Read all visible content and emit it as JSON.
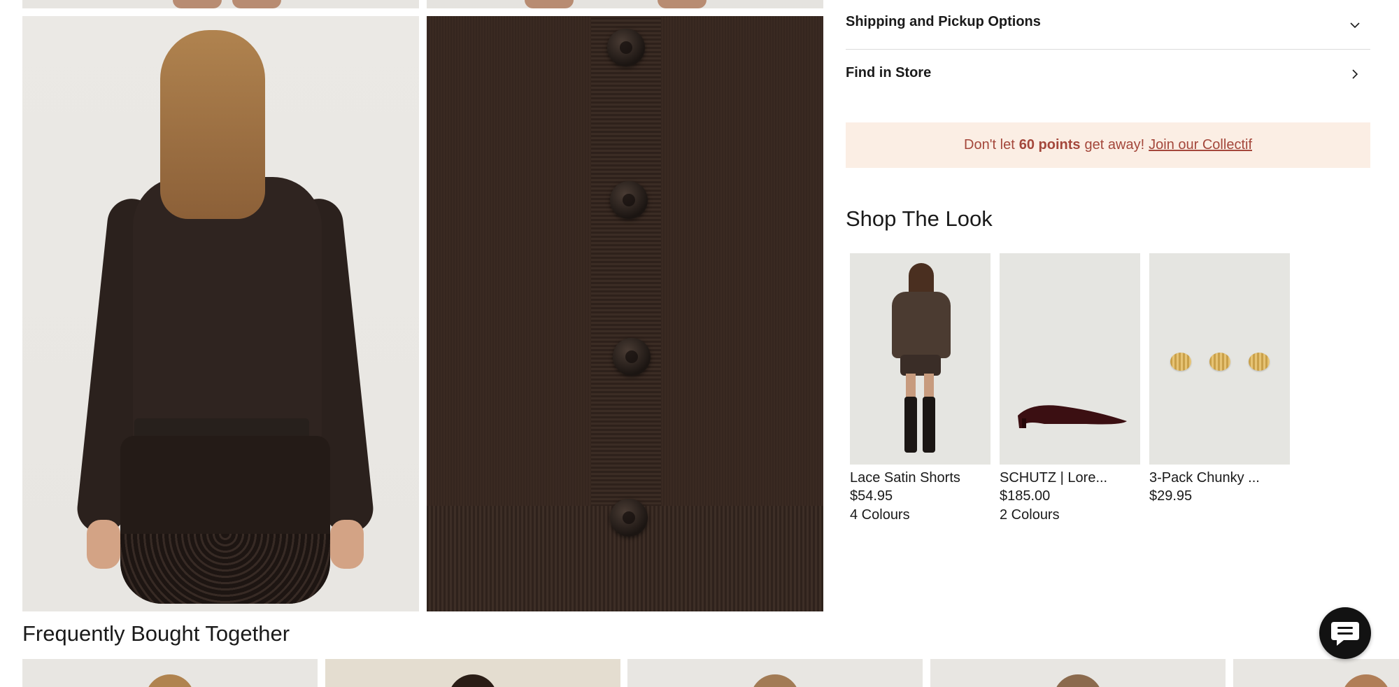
{
  "accordion": {
    "shipping_label": "Shipping and Pickup Options",
    "find_store_label": "Find in Store"
  },
  "promo": {
    "prefix": "Don't let",
    "points": "60 points",
    "suffix": "get away!",
    "link": "Join our Collectif"
  },
  "shop_the_look": {
    "title": "Shop The Look",
    "items": [
      {
        "name": "Lace Satin Shorts",
        "price": "$54.95",
        "colours": "4 Colours"
      },
      {
        "name": "SCHUTZ | Lore...",
        "price": "$185.00",
        "colours": "2 Colours"
      },
      {
        "name": "3-Pack Chunky ...",
        "price": "$29.95",
        "colours": ""
      }
    ]
  },
  "frequently_bought": {
    "title": "Frequently Bought Together"
  },
  "icons": {
    "chevron_down": "chevron-down-icon",
    "chevron_right": "chevron-right-icon",
    "chat": "chat-bubble-icon"
  },
  "colors": {
    "promo_bg": "#fbeee4",
    "promo_text": "#a4473b",
    "chat_bg": "#121212"
  }
}
